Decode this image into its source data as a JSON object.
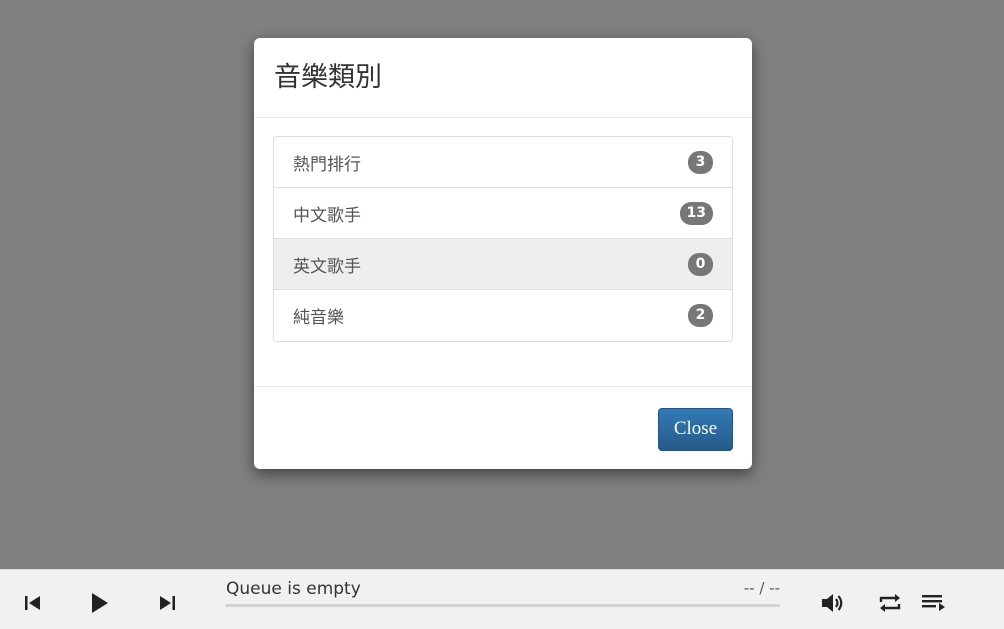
{
  "modal": {
    "title": "音樂類別",
    "categories": [
      {
        "label": "熱門排行",
        "count": "3"
      },
      {
        "label": "中文歌手",
        "count": "13"
      },
      {
        "label": "英文歌手",
        "count": "0"
      },
      {
        "label": "純音樂",
        "count": "2"
      }
    ],
    "close_label": "Close"
  },
  "player": {
    "track_title": "Queue is empty",
    "time": "-- / --",
    "progress_fraction": 0,
    "icons": {
      "prev": "skip-previous-icon",
      "play": "play-icon",
      "next": "skip-next-icon",
      "volume": "volume-icon",
      "repeat": "repeat-icon",
      "queue": "queue-icon"
    }
  },
  "colors": {
    "backdrop": "#808080",
    "primary_button": "#2d6ca2",
    "badge": "#777777",
    "player_bar": "#f1f1f1"
  }
}
